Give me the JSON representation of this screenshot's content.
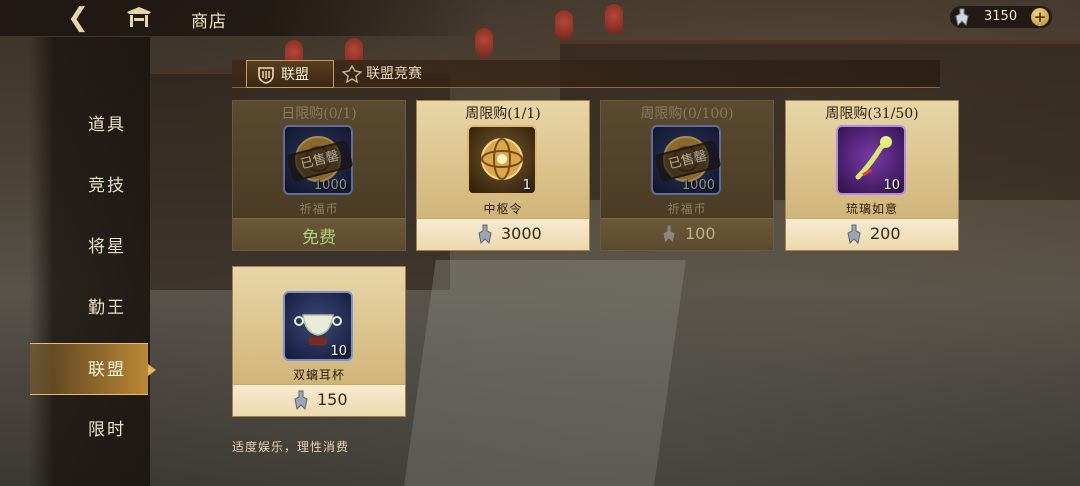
{
  "header": {
    "title": "商店",
    "back_icon": "back-arrow-icon",
    "home_icon": "gate-icon",
    "currency_value": "3150",
    "currency_icon": "token-icon",
    "plus_label": "+"
  },
  "sidebar": {
    "items": [
      {
        "label": "道具",
        "active": false
      },
      {
        "label": "竞技",
        "active": false
      },
      {
        "label": "将星",
        "active": false
      },
      {
        "label": "勤王",
        "active": false
      },
      {
        "label": "联盟",
        "active": true
      },
      {
        "label": "限时",
        "active": false
      }
    ]
  },
  "tabs": [
    {
      "label": "联盟",
      "icon": "shield-icon",
      "active": true
    },
    {
      "label": "联盟竞赛",
      "icon": "crest-icon",
      "active": false
    }
  ],
  "items": [
    {
      "limit": "日限购(0/1)",
      "name": "祈福币",
      "qty": "1000",
      "price": "",
      "free_label": "免费",
      "sold_out": true,
      "stamp": "已售罄",
      "icon_style": "blue"
    },
    {
      "limit": "周限购(1/1)",
      "name": "中枢令",
      "qty": "1",
      "price": "3000",
      "free_label": "",
      "sold_out": false,
      "stamp": "",
      "icon_style": "gold"
    },
    {
      "limit": "周限购(0/100)",
      "name": "祈福币",
      "qty": "1000",
      "price": "100",
      "free_label": "",
      "sold_out": true,
      "stamp": "已售罄",
      "icon_style": "blue"
    },
    {
      "limit": "周限购(31/50)",
      "name": "琉璃如意",
      "qty": "10",
      "price": "200",
      "free_label": "",
      "sold_out": false,
      "stamp": "",
      "icon_style": "purple"
    },
    {
      "limit": "",
      "name": "双螭耳杯",
      "qty": "10",
      "price": "150",
      "free_label": "",
      "sold_out": false,
      "stamp": "",
      "icon_style": "blue"
    }
  ],
  "footer": {
    "note": "适度娱乐，理性消费"
  },
  "colors": {
    "accent_gold": "#e6be6a",
    "card_light": "#e8d5a6",
    "card_dark": "#5a4a30",
    "free_green": "#a8d47a"
  }
}
